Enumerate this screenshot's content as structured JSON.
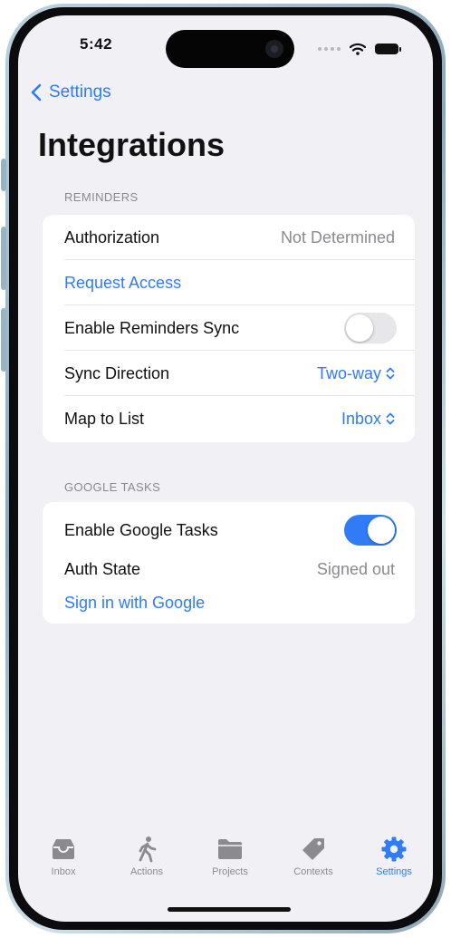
{
  "status_bar": {
    "time": "5:42"
  },
  "nav": {
    "back_label": "Settings",
    "title": "Integrations"
  },
  "reminders": {
    "header": "REMINDERS",
    "authorization_label": "Authorization",
    "authorization_value": "Not Determined",
    "request_access_label": "Request Access",
    "enable_sync_label": "Enable Reminders Sync",
    "enable_sync_on": false,
    "sync_direction_label": "Sync Direction",
    "sync_direction_value": "Two-way",
    "map_to_list_label": "Map to List",
    "map_to_list_value": "Inbox"
  },
  "google_tasks": {
    "header": "GOOGLE TASKS",
    "enable_label": "Enable Google Tasks",
    "enable_on": true,
    "auth_state_label": "Auth State",
    "auth_state_value": "Signed out",
    "sign_in_label": "Sign in with Google"
  },
  "tab_bar": {
    "tabs": [
      {
        "label": "Inbox",
        "icon": "inbox-tray-icon"
      },
      {
        "label": "Actions",
        "icon": "walking-figure-icon"
      },
      {
        "label": "Projects",
        "icon": "folder-icon"
      },
      {
        "label": "Contexts",
        "icon": "tag-icon"
      },
      {
        "label": "Settings",
        "icon": "gear-icon"
      }
    ],
    "active": "Settings"
  },
  "colors": {
    "accent": "#2f7cf6",
    "background": "#f1f1f5",
    "secondary_text": "#8a8a8f"
  }
}
